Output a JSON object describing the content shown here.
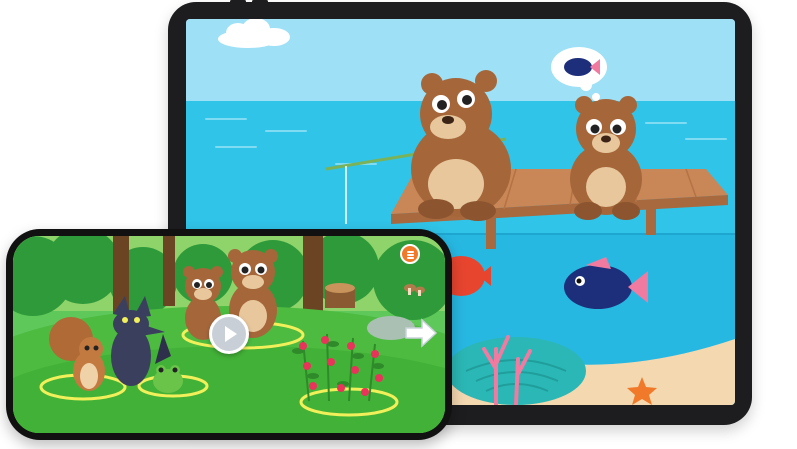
{
  "scene": {
    "tablet": {
      "device": "tablet",
      "screen": "bears-fishing-scene"
    },
    "phone": {
      "device": "phone",
      "screen": "forest-animals-scene"
    }
  },
  "colors": {
    "sky": "#9ee0f5",
    "sea": "#30c4e8",
    "underwater": "#27b8e2",
    "sand": "#f4d8b0",
    "pier": "#c98656",
    "bear": "#a5673a",
    "grass": "#3fb33f",
    "accent_orange": "#f07a2a"
  },
  "icons": {
    "menu": "menu-icon",
    "play": "play-icon",
    "next": "arrow-right-icon",
    "fish_thought": "thought-bubble-fish-icon"
  }
}
